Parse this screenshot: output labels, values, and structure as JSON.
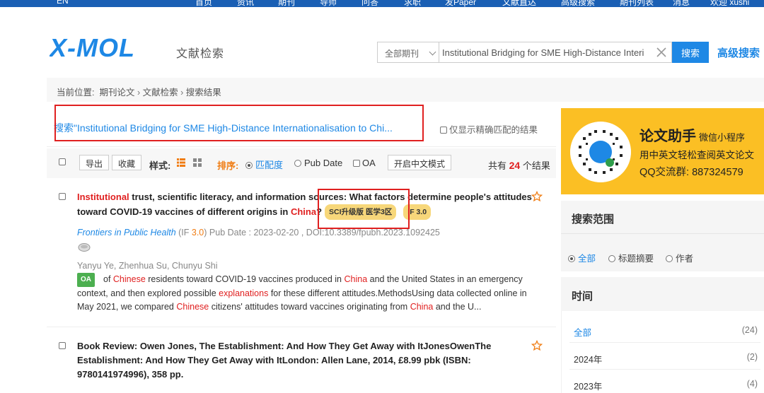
{
  "nav": {
    "items": [
      "EN",
      "首页",
      "资讯",
      "期刊",
      "导师",
      "问答",
      "求职",
      "发Paper",
      "文献直达",
      "高级搜索",
      "期刊列表",
      "消息",
      "欢迎 xushi"
    ]
  },
  "header": {
    "logo_text": "X-MOL",
    "logo_sub": "文献检索",
    "scope_select": "全部期刊",
    "search_value": "Institutional Bridging for SME High-Distance Interi",
    "search_button": "搜索",
    "advanced_search": "高级搜索"
  },
  "breadcrumb": {
    "label": "当前位置:",
    "items": [
      "期刊论文",
      "文献检索",
      "搜索结果"
    ]
  },
  "query": {
    "text": "搜索\"Institutional Bridging for SME High-Distance Internationalisation to Chi...",
    "exact_label": "仅显示精确匹配的结果"
  },
  "toolbar": {
    "export": "导出",
    "collect": "收藏",
    "style_label": "样式:",
    "sort_label": "排序:",
    "sort_relevance": "匹配度",
    "sort_pubdate": "Pub Date",
    "oa": "OA",
    "chinese_mode": "开启中文模式",
    "total_prefix": "共有",
    "total_count": "24",
    "total_suffix": "个结果"
  },
  "results": [
    {
      "title_hl1": "Institutional",
      "title_mid": " trust, scientific literacy, and information sources: What factors determine people's attitudes toward COVID-19 vaccines of different origins in ",
      "title_hl2": "China",
      "title_end": "?",
      "badge_sci": "SCI升级版 医学3区",
      "badge_if": "IF 3.0",
      "journal": "Frontiers in Public Health",
      "if_open": " (IF ",
      "if_value": "3.0",
      "if_close": ")",
      "pub_date": " Pub Date : 2023-02-20 , DOI:10.3389/fpubh.2023.1092425",
      "authors": "Yanyu Ye, Zhenhua Su, Chunyu Shi",
      "oa": "OA",
      "abstract": {
        "a1": "of ",
        "h1": "Chinese",
        "a2": " residents toward COVID-19 vaccines produced in ",
        "h2": "China",
        "a3": " and the United States in an emergency context, and then explored possible ",
        "h3": "explanations",
        "a4": " for these different attitudes.MethodsUsing data collected online in May 2021, we compared ",
        "h4": "Chinese",
        "a5": " citizens' attitudes toward vaccines originating from ",
        "h5": "China",
        "a6": " and the U..."
      }
    },
    {
      "title": "Book Review: Owen Jones, The Establishment: And How They Get Away with ItJonesOwenThe Establishment: And How They Get Away with ItLondon: Allen Lane, 2014, £8.99 pbk (ISBN: 9780141974996), 358 pp."
    }
  ],
  "promo": {
    "title": "论文助手",
    "subtitle": "微信小程序",
    "line1": "用中英文轻松查阅英文论文",
    "line2": "QQ交流群: 887324579"
  },
  "search_scope": {
    "title": "搜索范围",
    "options": [
      "全部",
      "标题摘要",
      "作者"
    ]
  },
  "time_filter": {
    "title": "时间",
    "rows": [
      {
        "label": "全部",
        "count": "(24)"
      },
      {
        "label": "2024年",
        "count": "(2)"
      },
      {
        "label": "2023年",
        "count": "(4)"
      }
    ]
  },
  "colors": {
    "accent": "#1e88e5",
    "highlight": "#e02020",
    "promo": "#fbbf24",
    "sort": "#f07d14"
  }
}
